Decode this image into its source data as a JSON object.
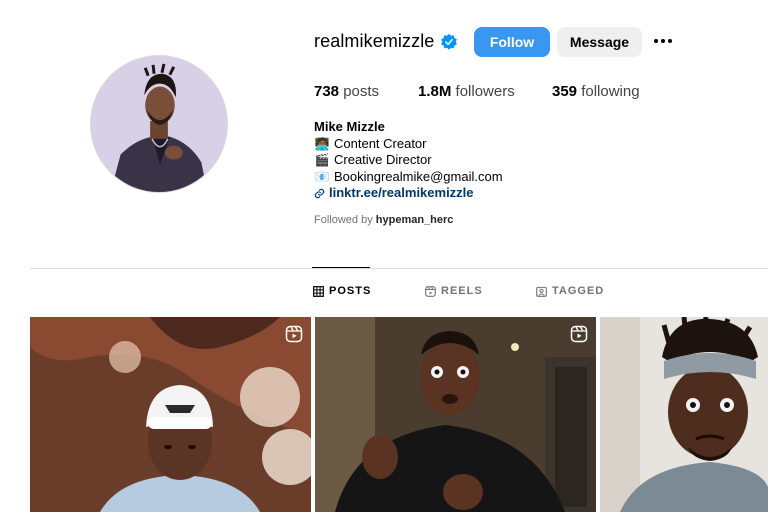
{
  "profile": {
    "username": "realmikemizzle",
    "verified": true,
    "follow_label": "Follow",
    "message_label": "Message",
    "stats": {
      "posts_count": "738",
      "posts_label": "posts",
      "followers_count": "1.8M",
      "followers_label": "followers",
      "following_count": "359",
      "following_label": "following"
    },
    "bio": {
      "name": "Mike Mizzle",
      "lines": [
        {
          "emoji": "🧑🏾‍💻",
          "text": "Content Creator"
        },
        {
          "emoji": "🎬",
          "text": "Creative Director"
        },
        {
          "emoji": "📧",
          "text": "Bookingrealmike@gmail.com"
        }
      ],
      "link": "linktr.ee/realmikemizzle"
    },
    "followed_by_prefix": "Followed by",
    "followed_by_user": "hypeman_herc"
  },
  "tabs": [
    {
      "label": "POSTS",
      "icon": "grid-icon",
      "active": true
    },
    {
      "label": "REELS",
      "icon": "reels-icon",
      "active": false
    },
    {
      "label": "TAGGED",
      "icon": "tagged-icon",
      "active": false
    }
  ],
  "posts": [
    {
      "type": "reel",
      "icon": "reel-badge-icon"
    },
    {
      "type": "reel",
      "icon": "reel-badge-icon"
    },
    {
      "type": "photo"
    }
  ],
  "colors": {
    "follow_button": "#3897f0",
    "link": "#00376b",
    "verified_badge": "#0095f6"
  }
}
